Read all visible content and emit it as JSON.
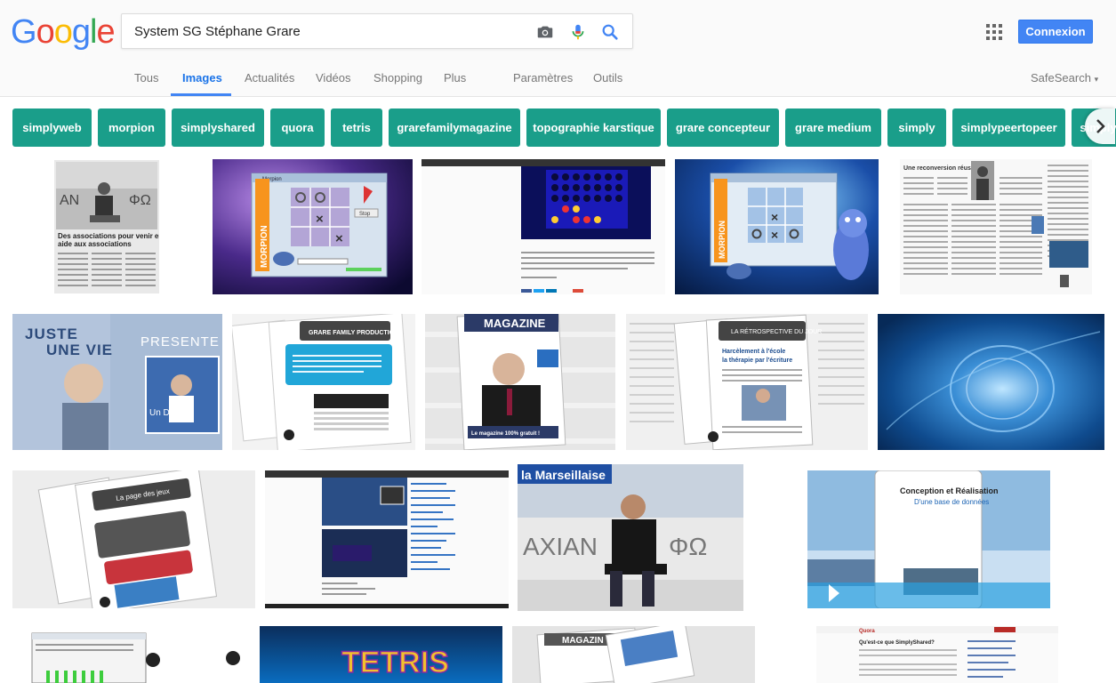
{
  "logo": {
    "letters": [
      "G",
      "o",
      "o",
      "g",
      "l",
      "e"
    ],
    "colors": [
      "#4285f4",
      "#ea4335",
      "#fbbc05",
      "#4285f4",
      "#34a853",
      "#ea4335"
    ]
  },
  "search": {
    "query": "System SG Stéphane Grare"
  },
  "header": {
    "connexion_label": "Connexion",
    "safesearch_label": "SafeSearch"
  },
  "tabs": [
    {
      "label": "Tous"
    },
    {
      "label": "Images"
    },
    {
      "label": "Actualités"
    },
    {
      "label": "Vidéos"
    },
    {
      "label": "Shopping"
    },
    {
      "label": "Plus"
    },
    {
      "label": "Paramètres"
    },
    {
      "label": "Outils"
    }
  ],
  "chips": [
    "simplyweb",
    "morpion",
    "simplyshared",
    "quora",
    "tetris",
    "grarefamilymagazine",
    "topographie karstique",
    "grare concepteur",
    "grare medium",
    "simply",
    "simplypeertopeer",
    "simply"
  ],
  "thumb_text": {
    "assoc_headline": "Des associations pour venir en aide aux associations",
    "assoc_letters_left": "ΑΝ",
    "assoc_letters_right": "ΦΩ",
    "morpion_side": "MORPION",
    "morpion_btn": "Stop",
    "morpion_title": "Morpion",
    "juste_une_vie": "JUSTE UNE VIE",
    "presente": "PRESENTE",
    "destin": "Un Destin",
    "grare_family": "GRARE FAMILY PRODUCTION",
    "magazine": "MAGAZINE",
    "magazine_footer": "Le magazine 100% gratuit !",
    "retro_title": "LA RÉTROSPECTIVE DU JOUR",
    "retro_sub": "Harcèlement à l'école la thérapie par l'écriture",
    "pages_title": "La page des jeux",
    "marseillaise": "la Marseillaise",
    "marseillaise_letters_left": "ΑΧΙΑΝ",
    "marseillaise_letters_right": "ΦΩ",
    "conception_title": "Conception et Réalisation",
    "conception_sub": "D'une base de données",
    "tetris": "TETRIS",
    "magazine2": "MAGAZIN",
    "quora": "Quora",
    "quora_q": "Qu'est-ce que SimplyShared?"
  }
}
